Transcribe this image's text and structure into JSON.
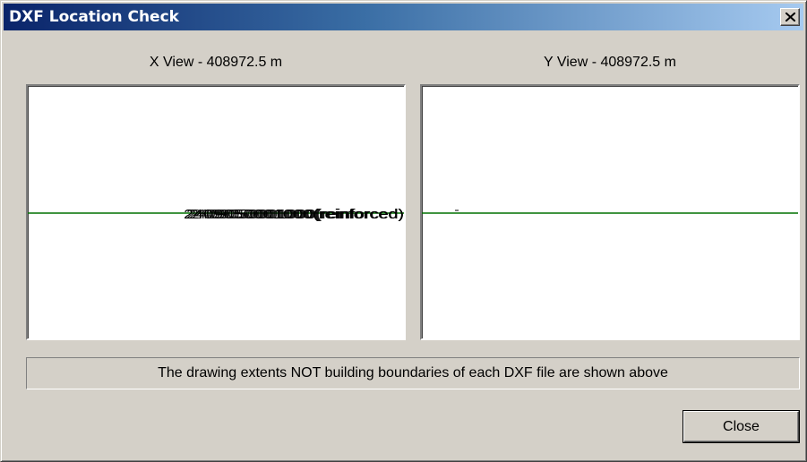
{
  "window": {
    "title": "DXF Location Check",
    "close_icon": "close-x-icon"
  },
  "x_view": {
    "label": "X View - 408972.5 m",
    "line_color": "#007000",
    "overlapping_label_text": "2409050001000(reinforced)"
  },
  "y_view": {
    "label": "Y View - 408972.5 m",
    "line_color": "#007000"
  },
  "status_message": "The drawing extents NOT building boundaries of each DXF file are shown above",
  "buttons": {
    "close_label": "Close"
  },
  "colors": {
    "dialog_face": "#d4d0c8",
    "title_gradient_start": "#0a246a",
    "title_gradient_end": "#a6caf0",
    "title_text": "#ffffff"
  }
}
